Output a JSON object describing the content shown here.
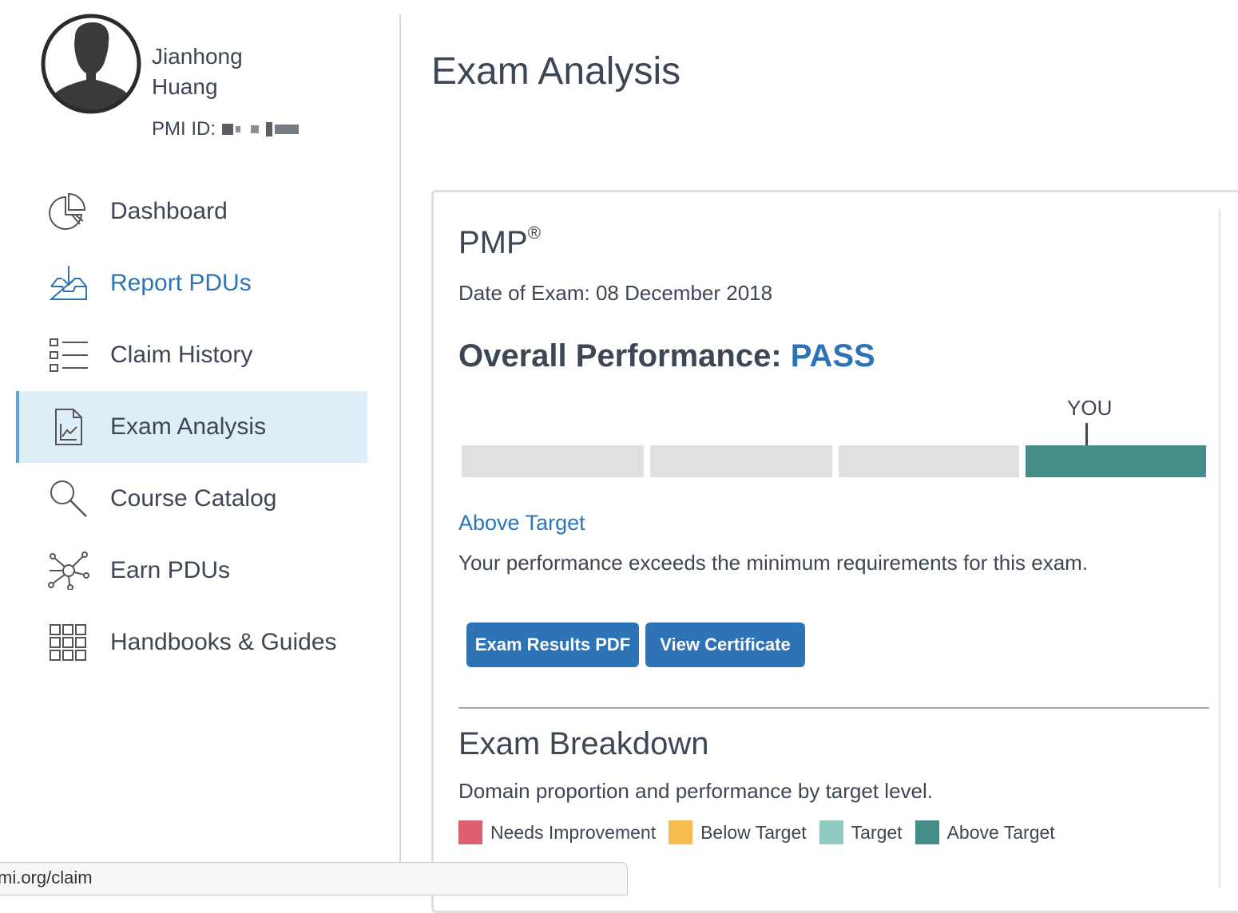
{
  "user": {
    "first_name": "Jianhong",
    "last_name": "Huang",
    "pmi_id_label": "PMI ID:"
  },
  "nav": {
    "items": [
      {
        "label": "Dashboard",
        "icon": "pie-chart-icon"
      },
      {
        "label": "Report PDUs",
        "icon": "inbox-download-icon",
        "highlighted": true
      },
      {
        "label": "Claim History",
        "icon": "list-icon"
      },
      {
        "label": "Exam Analysis",
        "icon": "document-chart-icon",
        "active": true
      },
      {
        "label": "Course Catalog",
        "icon": "search-icon"
      },
      {
        "label": "Earn PDUs",
        "icon": "network-icon"
      },
      {
        "label": "Handbooks & Guides",
        "icon": "grid-icon"
      }
    ]
  },
  "page": {
    "title": "Exam Analysis"
  },
  "exam": {
    "name": "PMP",
    "registered_mark": "®",
    "date_text": "Date of Exam: 08 December 2018",
    "overall_label": "Overall Performance:",
    "overall_result": "PASS",
    "you_marker": "YOU",
    "performance_level_index": 4,
    "performance_levels_total": 4,
    "level_title": "Above Target",
    "level_description": "Your performance exceeds the minimum requirements for this exam.",
    "buttons": {
      "results_pdf": "Exam Results PDF",
      "view_certificate": "View Certificate"
    }
  },
  "breakdown": {
    "title": "Exam Breakdown",
    "description": "Domain proportion and performance by target level.",
    "legend": [
      {
        "label": "Needs Improvement",
        "color": "#de5f6f"
      },
      {
        "label": "Below Target",
        "color": "#f4bd4d"
      },
      {
        "label": "Target",
        "color": "#8fcbc0"
      },
      {
        "label": "Above Target",
        "color": "#468e89"
      }
    ]
  },
  "colors": {
    "accent": "#2c73b8",
    "active_nav_bg": "#ddeef8",
    "button_bg": "#2e73b6",
    "bar_empty": "#e0e0e0",
    "bar_filled": "#468e89"
  },
  "status_bar": {
    "url": "mi.org/claim"
  }
}
